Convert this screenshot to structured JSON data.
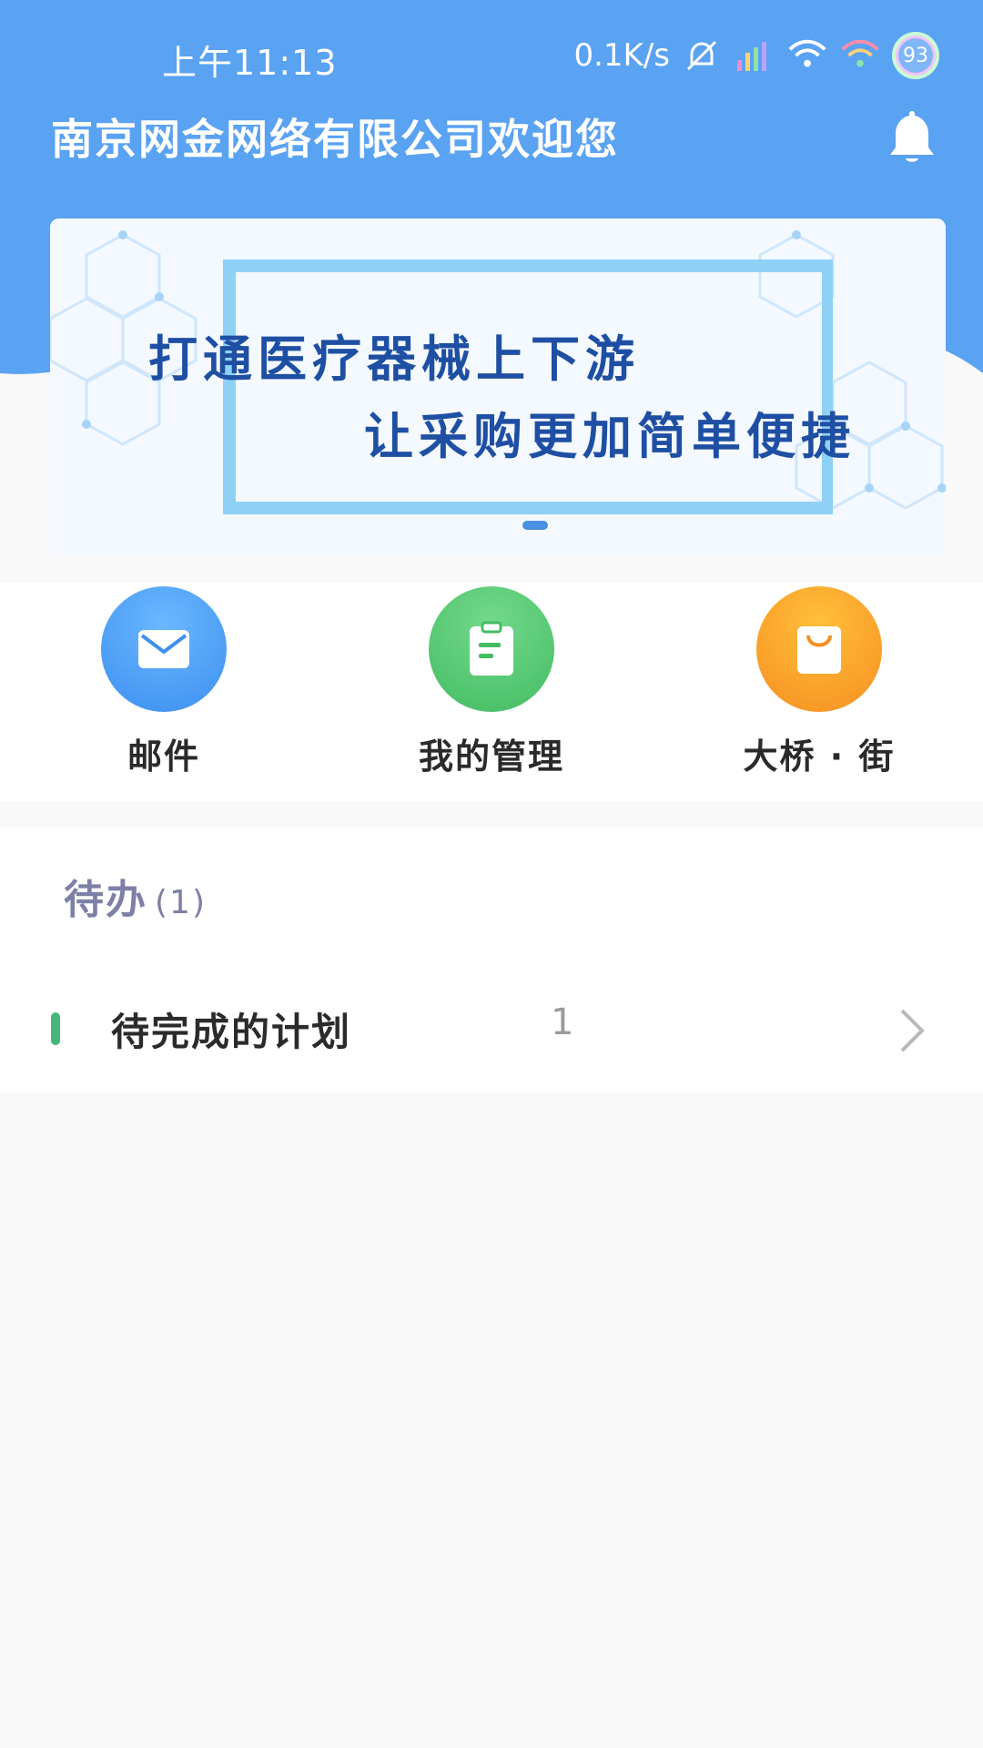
{
  "status_bar": {
    "time": "上午11:13",
    "net_speed": "0.1K/s",
    "battery": "93",
    "icons": [
      "mute-icon",
      "signal-icon",
      "wifi-icon",
      "wifi-icon"
    ]
  },
  "header": {
    "title": "南京网金网络有限公司欢迎您",
    "bell_icon": "bell-icon",
    "background_color": "#5aa2f2"
  },
  "banner": {
    "line1": "打通医疗器械上下游",
    "line2": "让采购更加简单便捷",
    "text_color": "#1e4fa3",
    "frame_color": "#8fd1f6"
  },
  "actions": [
    {
      "label": "邮件",
      "icon": "mail-icon",
      "color": "#3d93f0"
    },
    {
      "label": "我的管理",
      "icon": "clipboard-icon",
      "color": "#4dc46c"
    },
    {
      "label": "大桥 · 街",
      "icon": "shopping-bag-icon",
      "color": "#f7a328"
    }
  ],
  "todo": {
    "title": "待办",
    "count": "(1)",
    "items": [
      {
        "label": "待完成的计划",
        "value": "1",
        "marker_color": "#43b87a"
      }
    ]
  }
}
